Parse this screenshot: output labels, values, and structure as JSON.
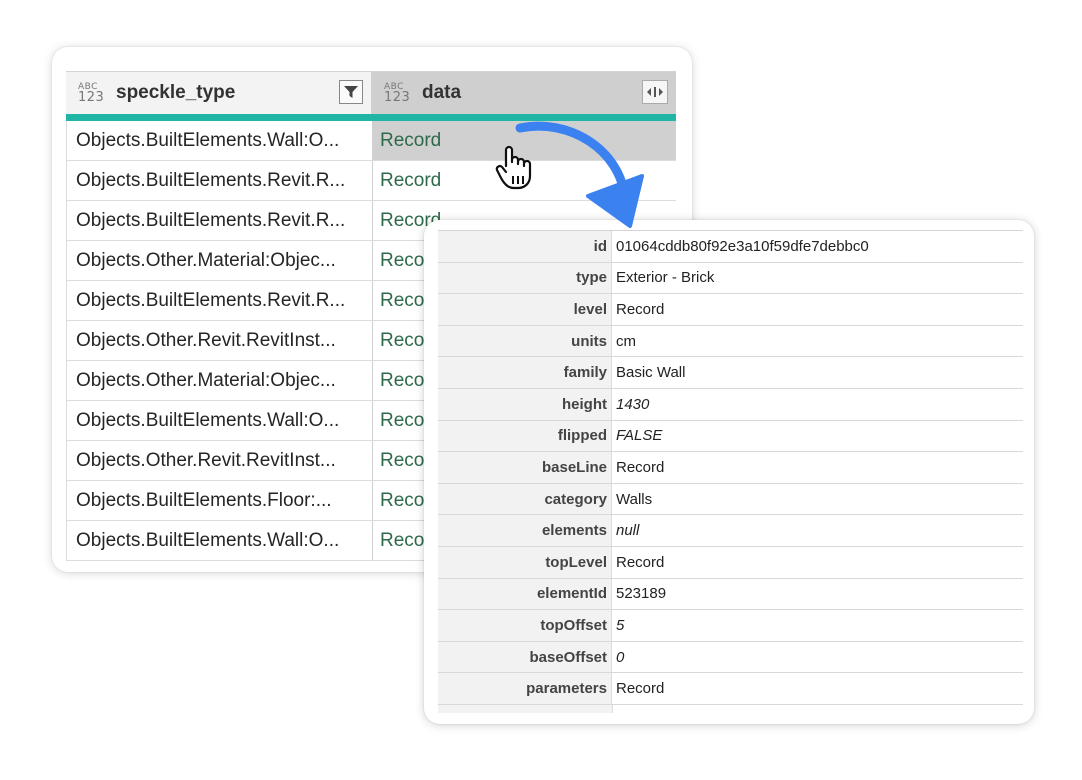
{
  "table": {
    "columns": [
      {
        "type_top": "ABC",
        "type_bottom": "123",
        "label": "speckle_type",
        "button": "filter-icon"
      },
      {
        "type_top": "ABC",
        "type_bottom": "123",
        "label": "data",
        "button": "expand-icon"
      }
    ],
    "rows": [
      {
        "speckle_type": "Objects.BuiltElements.Wall:O...",
        "data": "Record"
      },
      {
        "speckle_type": "Objects.BuiltElements.Revit.R...",
        "data": "Record"
      },
      {
        "speckle_type": "Objects.BuiltElements.Revit.R...",
        "data": "Record"
      },
      {
        "speckle_type": "Objects.Other.Material:Objec...",
        "data": "Reco"
      },
      {
        "speckle_type": "Objects.BuiltElements.Revit.R...",
        "data": "Reco"
      },
      {
        "speckle_type": "Objects.Other.Revit.RevitInst...",
        "data": "Reco"
      },
      {
        "speckle_type": "Objects.Other.Material:Objec...",
        "data": "Reco"
      },
      {
        "speckle_type": "Objects.BuiltElements.Wall:O...",
        "data": "Reco"
      },
      {
        "speckle_type": "Objects.Other.Revit.RevitInst...",
        "data": "Reco"
      },
      {
        "speckle_type": "Objects.BuiltElements.Floor:...",
        "data": "Reco"
      },
      {
        "speckle_type": "Objects.BuiltElements.Wall:O...",
        "data": "Reco"
      }
    ],
    "selected_row": 0,
    "accent_color": "#1fb6a6",
    "record_text_color": "#2d6a4a"
  },
  "record": {
    "fields": [
      {
        "key": "id",
        "value": "01064cddb80f92e3a10f59dfe7debbc0",
        "italic": false
      },
      {
        "key": "type",
        "value": "Exterior - Brick",
        "italic": false
      },
      {
        "key": "level",
        "value": "Record",
        "italic": false
      },
      {
        "key": "units",
        "value": "cm",
        "italic": false
      },
      {
        "key": "family",
        "value": "Basic Wall",
        "italic": false
      },
      {
        "key": "height",
        "value": "1430",
        "italic": true
      },
      {
        "key": "flipped",
        "value": "FALSE",
        "italic": true
      },
      {
        "key": "baseLine",
        "value": "Record",
        "italic": false
      },
      {
        "key": "category",
        "value": "Walls",
        "italic": false
      },
      {
        "key": "elements",
        "value": "null",
        "italic": true
      },
      {
        "key": "topLevel",
        "value": "Record",
        "italic": false
      },
      {
        "key": "elementId",
        "value": "523189",
        "italic": false
      },
      {
        "key": "topOffset",
        "value": "5",
        "italic": true
      },
      {
        "key": "baseOffset",
        "value": "0",
        "italic": true
      },
      {
        "key": "parameters",
        "value": "Record",
        "italic": false
      }
    ]
  },
  "annotations": {
    "cursor": "hand-pointer-icon",
    "arrow": "curved-arrow",
    "arrow_color": "#3b82f0"
  }
}
